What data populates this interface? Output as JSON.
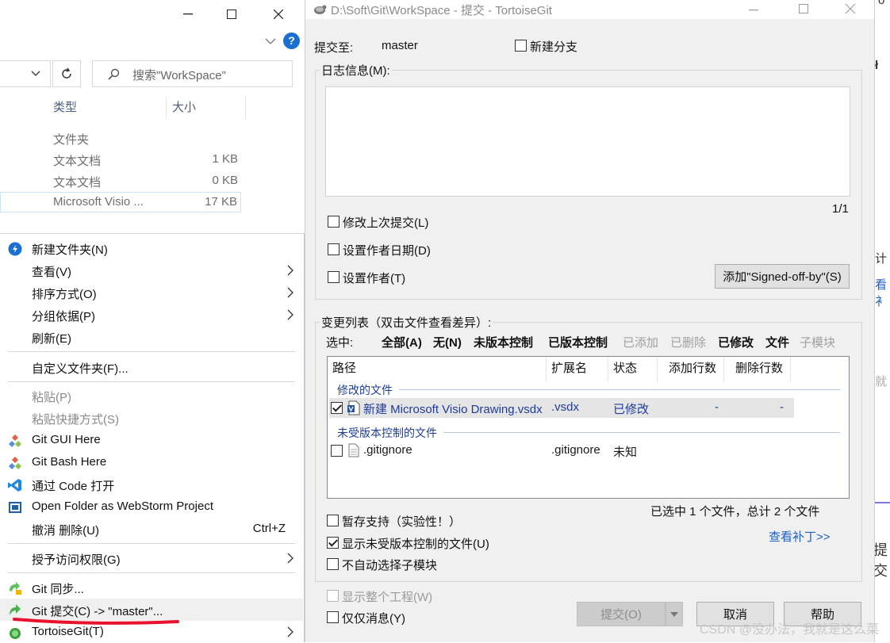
{
  "explorer": {
    "search_placeholder": "搜索\"WorkSpace\"",
    "columns": {
      "type": "类型",
      "size": "大小"
    },
    "files": [
      {
        "type": "文件夹",
        "size": ""
      },
      {
        "type": "文本文档",
        "size": "1 KB"
      },
      {
        "type": "文本文档",
        "size": "0 KB"
      },
      {
        "type": "Microsoft Visio ...",
        "size": "17 KB"
      }
    ],
    "help_glyph": "?"
  },
  "context_menu": {
    "items": [
      {
        "label": "新建文件夹(N)"
      },
      {
        "label": "查看(V)"
      },
      {
        "label": "排序方式(O)"
      },
      {
        "label": "分组依据(P)"
      },
      {
        "label": "刷新(E)"
      },
      {
        "label": "自定义文件夹(F)..."
      },
      {
        "label": "粘贴(P)"
      },
      {
        "label": "粘贴快捷方式(S)"
      },
      {
        "label": "Git GUI Here"
      },
      {
        "label": "Git Bash Here"
      },
      {
        "label": "通过 Code 打开"
      },
      {
        "label": "Open Folder as WebStorm Project"
      },
      {
        "label": "撤消 删除(U)",
        "shortcut": "Ctrl+Z"
      },
      {
        "label": "授予访问权限(G)"
      },
      {
        "label": "Git 同步..."
      },
      {
        "label": "Git 提交(C) -> \"master\"..."
      },
      {
        "label": "TortoiseGit(T)"
      }
    ]
  },
  "dialog": {
    "title": "D:\\Soft\\Git\\WorkSpace - 提交 - TortoiseGit",
    "commit_to_label": "提交至:",
    "branch": "master",
    "new_branch_label": "新建分支",
    "log_message_label": "日志信息(M):",
    "log_message_value": "",
    "page_counter": "1/1",
    "amend_label": "修改上次提交(L)",
    "set_author_date_label": "设置作者日期(D)",
    "set_author_label": "设置作者(T)",
    "signed_off_button": "添加\"Signed-off-by\"(S)",
    "changes_label": "变更列表（双击文件查看差异）:",
    "select_label": "选中:",
    "filters": {
      "all": "全部(A)",
      "none": "无(N)",
      "unversioned": "未版本控制",
      "versioned": "已版本控制",
      "added": "已添加",
      "deleted": "已删除",
      "modified": "已修改",
      "files": "文件",
      "submodules": "子模块"
    },
    "columns": {
      "path": "路径",
      "ext": "扩展名",
      "status": "状态",
      "added_lines": "添加行数",
      "deleted_lines": "删除行数"
    },
    "groups": [
      {
        "title": "修改的文件",
        "rows": [
          {
            "path": "新建 Microsoft Visio Drawing.vsdx",
            "ext": ".vsdx",
            "status": "已修改",
            "added": "-",
            "deleted": "-",
            "checked": true
          }
        ]
      },
      {
        "title": "未受版本控制的文件",
        "rows": [
          {
            "path": ".gitignore",
            "ext": ".gitignore",
            "status": "未知",
            "added": "",
            "deleted": "",
            "checked": false
          }
        ]
      }
    ],
    "selection_summary": "已选中 1 个文件，总计 2 个文件",
    "stash_label": "暂存支持（实验性！）",
    "show_unversioned_label": "显示未受版本控制的文件(U)",
    "no_auto_submodule_label": "不自动选择子模块",
    "view_patch_link": "查看补丁>>",
    "show_whole_project_label": "显示整个工程(W)",
    "message_only_label": "仅仅消息(Y)",
    "commit_button": "提交(O)",
    "cancel_button": "取消",
    "help_button": "帮助"
  },
  "sliver": {
    "frag1": "o",
    "frag2": "ł",
    "frag3": "计",
    "frag4": "看衤",
    "frag5": "就",
    "frag6": "提交"
  },
  "watermark": "CSDN @没办法，我就是这么菜",
  "colors": {
    "accent_blue": "#2060c8",
    "tortoise_green": "#5cc25c",
    "git_red": "#e04a32",
    "underline_red": "#e8122d"
  }
}
